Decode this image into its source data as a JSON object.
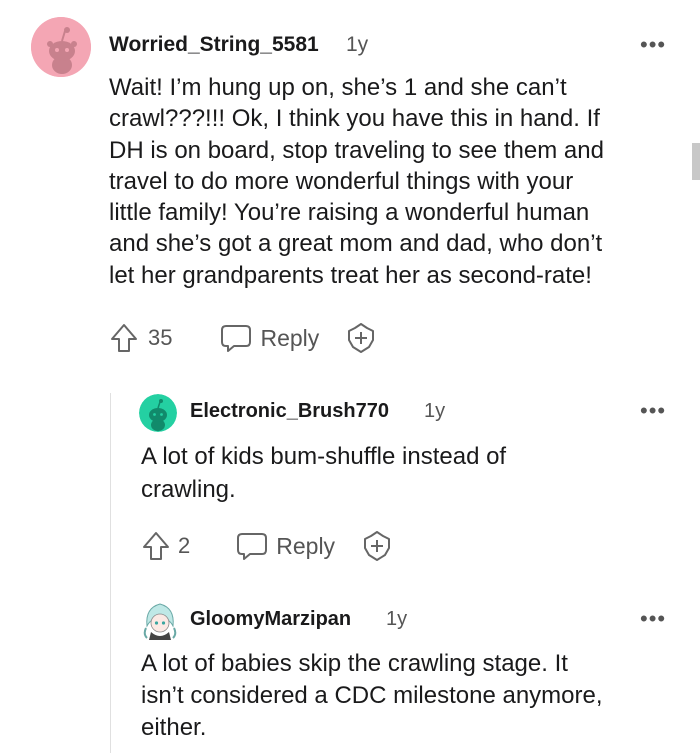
{
  "comments": [
    {
      "username": "Worried_String_5581",
      "age": "1y",
      "body": "Wait! I’m hung up on, she’s 1 and she can’t\ncrawl???!!! Ok, I think you have this in hand. If\nDH is on board, stop traveling to see them and\ntravel to do more wonderful things with your\nlittle family! You’re raising a wonderful human\nand she’s got a great mom and dad, who don’t\nlet her grandparents treat her as second-rate!",
      "upvotes": "35",
      "reply_label": "Reply",
      "avatar_color": "#f4a6b4"
    },
    {
      "username": "Electronic_Brush770",
      "age": "1y",
      "body": "A lot of kids bum-shuffle instead of\ncrawling.",
      "upvotes": "2",
      "reply_label": "Reply",
      "avatar_color": "#1fcf9f"
    },
    {
      "username": "GloomyMarzipan",
      "age": "1y",
      "body": "A lot of babies skip the crawling stage. It\nisn’t considered a CDC milestone anymore,\neither."
    }
  ],
  "more_label": "•••",
  "icons": {
    "upvote": "upvote-arrow-icon",
    "reply": "speech-bubble-icon",
    "award": "plus-circle-icon",
    "more": "more-dots-icon"
  }
}
